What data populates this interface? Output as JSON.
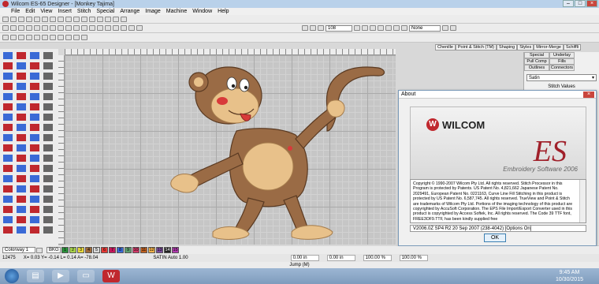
{
  "window": {
    "title": "Wilcom ES-65 Designer - [Monkey    Tajima]",
    "controls": [
      "–",
      "□",
      "×"
    ]
  },
  "menu": [
    "File",
    "Edit",
    "View",
    "Insert",
    "Stitch",
    "Special",
    "Arrange",
    "Image",
    "Machine",
    "Window",
    "Help"
  ],
  "toolbar": {
    "zoom": "108",
    "none_combo": "None"
  },
  "panel_tabs": [
    "Chenille",
    "Point & Stitch (TM)",
    "Shaping",
    "Styles",
    "Mirror-Merge",
    "Schiffli"
  ],
  "right_panel": {
    "subtabs": [
      "Special",
      "Underlay",
      "Pull Comp",
      "Fills",
      "Outlines",
      "Connectors"
    ],
    "stitch_type": "Satin",
    "stitch_values_label": "Stitch Values"
  },
  "about": {
    "title": "About",
    "logo_text": "WILCOM",
    "product": "ES",
    "subtitle": "Embroidery Software 2006",
    "copyright": "Copyright © 1990-2007 Wilcom Pty Ltd. All rights reserved. Stitch Processor in this Program is protected by Patents. US Patent No. 4,821,662 Japanese Patent No. 2029491, European Patent No. 0221163, Curve Line Fill Stitching in this product is protected by US Patent No. 6,587,745. All rights reserved. TrueView and Point & Stitch are trademarks of Wilcom Pty Ltd. Portions of the imaging technology of this product are copyrighted by AccuSoft Corporation. The EPS File Import/Export Converter used in this product is copyrighted by Access Softek, Inc. All rights reserved. The Code 39 TTF font, FREE3OF9.TTF, has been kindly supplied free",
    "version": "V2006.0Z SP4 R2 20 Sep 2007 (238-4042)  [Options On]",
    "ok_label": "OK"
  },
  "colorway": {
    "name": "Colorway 1",
    "bkg_label": "BKG",
    "colors": [
      {
        "n": "1",
        "c": "#2a8f3a"
      },
      {
        "n": "2",
        "c": "#a7d14a"
      },
      {
        "n": "3",
        "c": "#e9d93c"
      },
      {
        "n": "4",
        "c": "#a26b3a"
      },
      {
        "n": "5",
        "c": "#d8d8d8"
      },
      {
        "n": "6",
        "c": "#e53935"
      },
      {
        "n": "7",
        "c": "#c2185b"
      },
      {
        "n": "8",
        "c": "#3a6ad6"
      },
      {
        "n": "9",
        "c": "#5e9e6e"
      },
      {
        "n": "10",
        "c": "#d23b6a"
      },
      {
        "n": "11",
        "c": "#c06020"
      },
      {
        "n": "12",
        "c": "#f2b24a"
      },
      {
        "n": "13",
        "c": "#7a4a9a"
      },
      {
        "n": "14",
        "c": "#222222"
      },
      {
        "n": "15",
        "c": "#b23bb0"
      }
    ]
  },
  "status": {
    "stitches": "12475",
    "coords": "X= 0.03  Y= -0.14  L= 0.14  A= -78.04",
    "mode": "SATIN  Auto  1.00",
    "boxes": [
      "0.00 in",
      "0.00 in",
      "100.00 %",
      "100.00 %"
    ],
    "jump": "Jump (M)"
  },
  "clock": {
    "time": "9:45 AM",
    "date": "10/30/2015"
  },
  "colors": {
    "accent": "#c0282e",
    "monkey_brown": "#9a6b45",
    "monkey_light": "#e8c18a"
  }
}
